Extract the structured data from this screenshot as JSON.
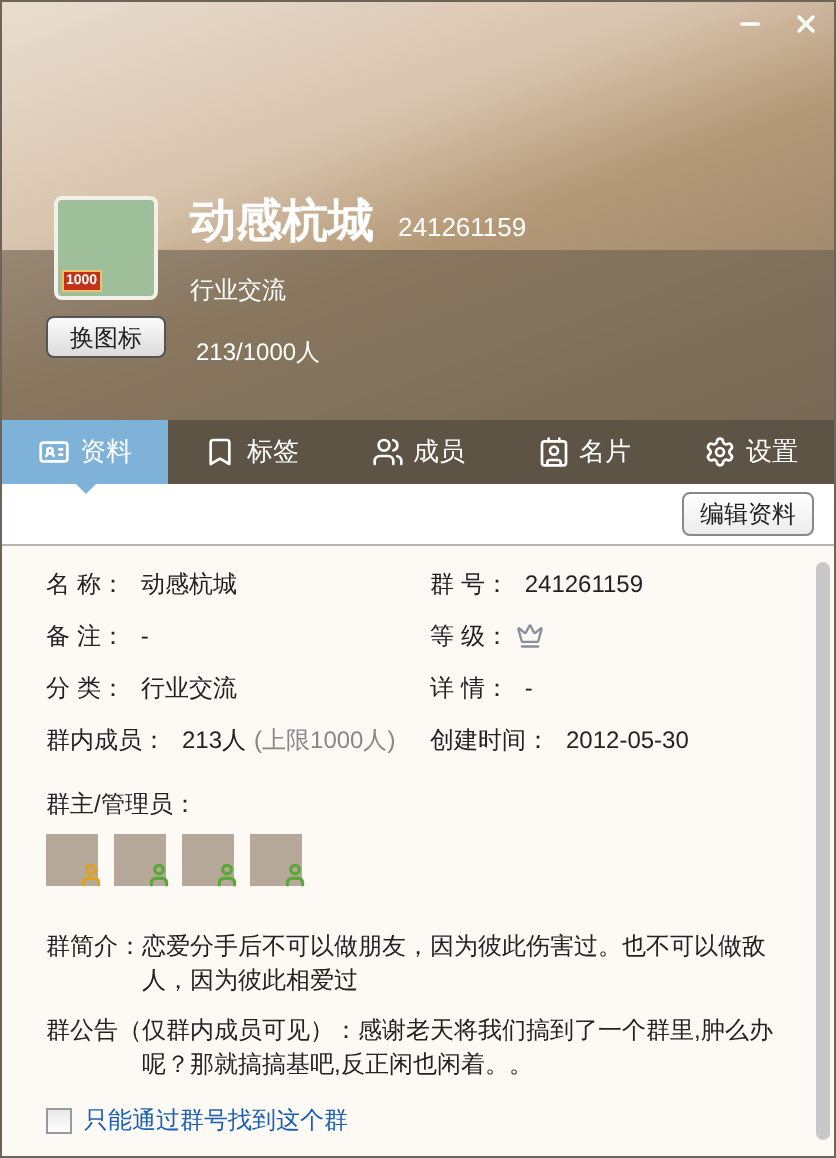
{
  "header": {
    "name": "动感杭城",
    "number": "241261159",
    "category": "行业交流",
    "badge": "1000",
    "change_icon_button": "换图标",
    "members": "213/1000人"
  },
  "tabs": [
    {
      "label": "资料",
      "selected": true
    },
    {
      "label": "标签",
      "selected": false
    },
    {
      "label": "成员",
      "selected": false
    },
    {
      "label": "名片",
      "selected": false
    },
    {
      "label": "设置",
      "selected": false
    }
  ],
  "edit_button": "编辑资料",
  "field_rows": [
    {
      "left": {
        "label": "名 称：",
        "value": "动感杭城",
        "kind": "text"
      },
      "right": {
        "label": "群 号：",
        "value": "241261159",
        "kind": "text"
      }
    },
    {
      "left": {
        "label": "备 注：",
        "value": "-",
        "kind": "text"
      },
      "right": {
        "label": "等 级：",
        "kind": "crown"
      }
    },
    {
      "left": {
        "label": "分 类：",
        "value": "行业交流",
        "kind": "text"
      },
      "right": {
        "label": "详 情：",
        "value": "-",
        "kind": "text"
      }
    },
    {
      "left": {
        "label": "群内成员：",
        "value": "213人",
        "note": "(上限1000人)",
        "kind": "text"
      },
      "right": {
        "label": "创建时间：",
        "value": "2012-05-30",
        "kind": "text"
      }
    }
  ],
  "admins_label": "群主/管理员：",
  "admins": [
    {
      "kind": "owner"
    },
    {
      "kind": "admin"
    },
    {
      "kind": "admin"
    },
    {
      "kind": "admin"
    }
  ],
  "intro": {
    "label": "群简介：",
    "text": "恋爱分手后不可以做朋友，因为彼此伤害过。也不可以做敌人，因为彼此相爱过"
  },
  "notice": {
    "label": "群公告（仅群内成员可见）：",
    "text": "感谢老天将我们搞到了一个群里,肿么办呢？那就搞搞基吧,反正闲也闲着。。"
  },
  "search_only": {
    "label": "只能通过群号找到这个群",
    "checked": false
  }
}
